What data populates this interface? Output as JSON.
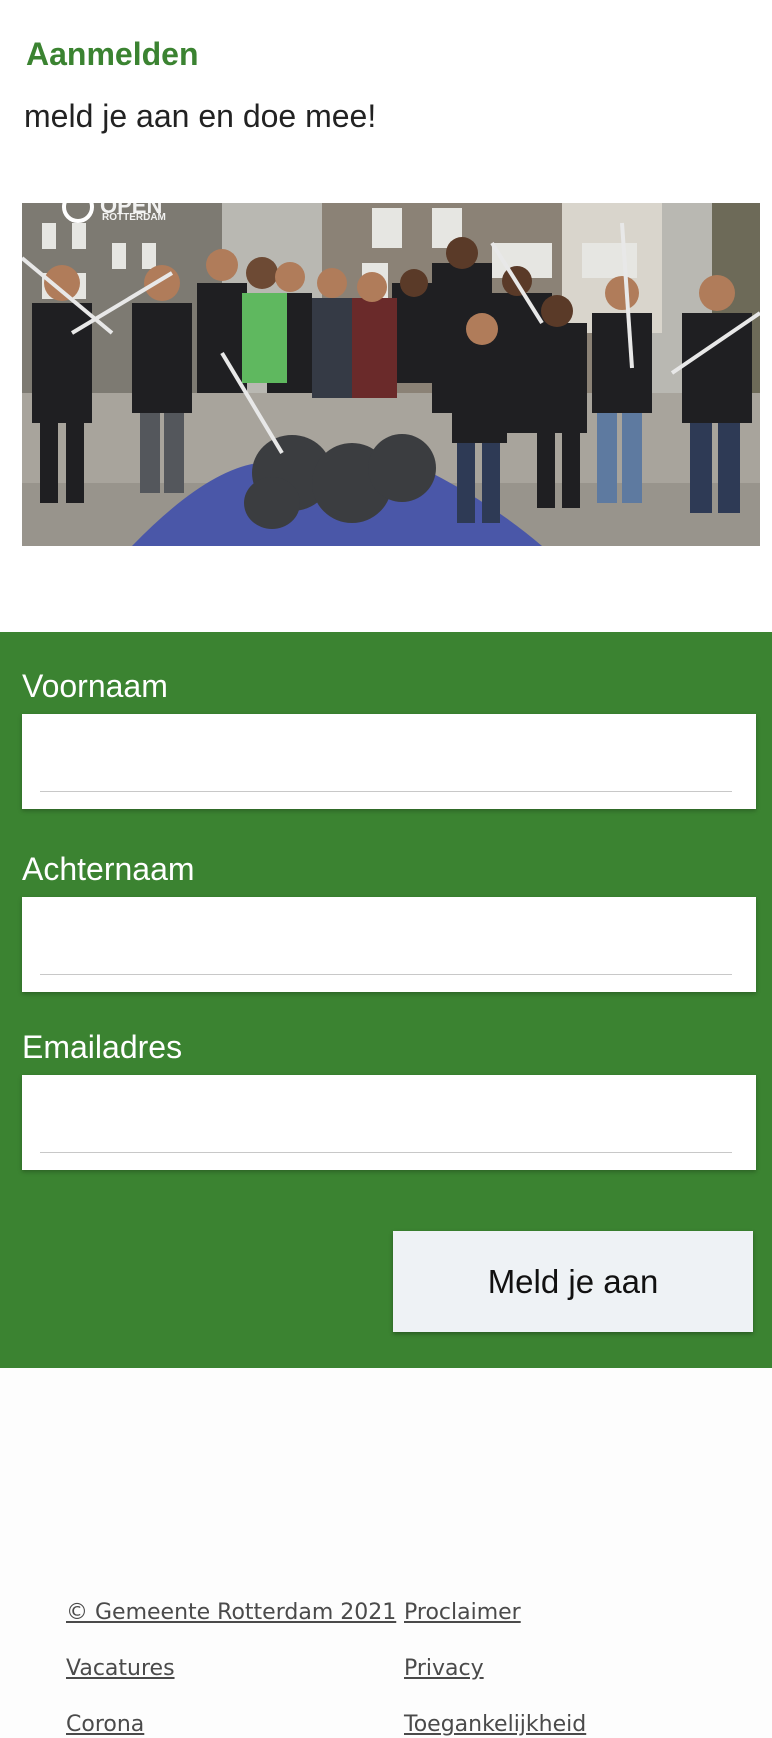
{
  "header": {
    "title": "Aanmelden",
    "subtitle": "meld je aan en doe mee!"
  },
  "photo": {
    "watermark_line1": "OPEN",
    "watermark_line2": "ROTTERDAM"
  },
  "form": {
    "fields": [
      {
        "label": "Voornaam",
        "value": "",
        "placeholder": ""
      },
      {
        "label": "Achternaam",
        "value": "",
        "placeholder": ""
      },
      {
        "label": "Emailadres",
        "value": "",
        "placeholder": ""
      }
    ],
    "submit_label": "Meld je aan",
    "panel_color": "#3b8331"
  },
  "footer": {
    "links": [
      "© Gemeente Rotterdam 2021",
      "Proclaimer",
      "Vacatures",
      "Privacy",
      "Corona",
      "Toegankelijkheid"
    ]
  },
  "colors": {
    "accent": "#3b8331",
    "button_bg": "#eef2f5"
  }
}
